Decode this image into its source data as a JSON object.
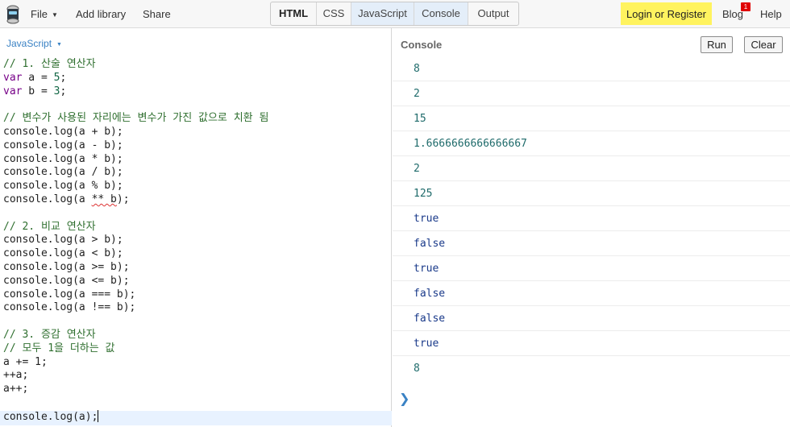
{
  "topbar": {
    "logo_icon": "jsbin-robot-icon",
    "file_label": "File",
    "add_library_label": "Add library",
    "share_label": "Share",
    "tabs": [
      "HTML",
      "CSS",
      "JavaScript",
      "Console",
      "Output"
    ],
    "login_label": "Login or Register",
    "blog_label": "Blog",
    "blog_badge": "1",
    "help_label": "Help"
  },
  "editor": {
    "language": "JavaScript",
    "lines": {
      "l1": "// 1. 산술 연산자",
      "l4": "// 변수가 사용된 자리에는 변수가 가진 값으로 치환 됨",
      "l5": "console.log(a + b);",
      "l6": "console.log(a - b);",
      "l7": "console.log(a * b);",
      "l8": "console.log(a / b);",
      "l9": "console.log(a % b);",
      "l11": "// 2. 비교 연산자",
      "l12": "console.log(a > b);",
      "l13": "console.log(a < b);",
      "l14": "console.log(a >= b);",
      "l15": "console.log(a <= b);",
      "l16": "console.log(a === b);",
      "l17": "console.log(a !== b);",
      "l19": "// 3. 증감 연산자",
      "l20": "// 모두 1을 더하는 값",
      "l21": "a += 1;",
      "l22": "++a;",
      "l23": "a++;",
      "l25": "console.log(a);"
    }
  },
  "console": {
    "title": "Console",
    "run_label": "Run",
    "clear_label": "Clear",
    "outputs": [
      "8",
      "2",
      "15",
      "1.6666666666666667",
      "2",
      "125",
      "true",
      "false",
      "true",
      "false",
      "false",
      "true",
      "8"
    ],
    "prompt_icon": "chevron-right-icon"
  },
  "colors": {
    "login_bg": "#fff35f",
    "tab_active_bg": "#e4eef9",
    "comment": "#2f6f2f",
    "keyword": "#770088",
    "number": "#116644",
    "accent_blue": "#3a82c4",
    "badge_red": "#e00000"
  }
}
